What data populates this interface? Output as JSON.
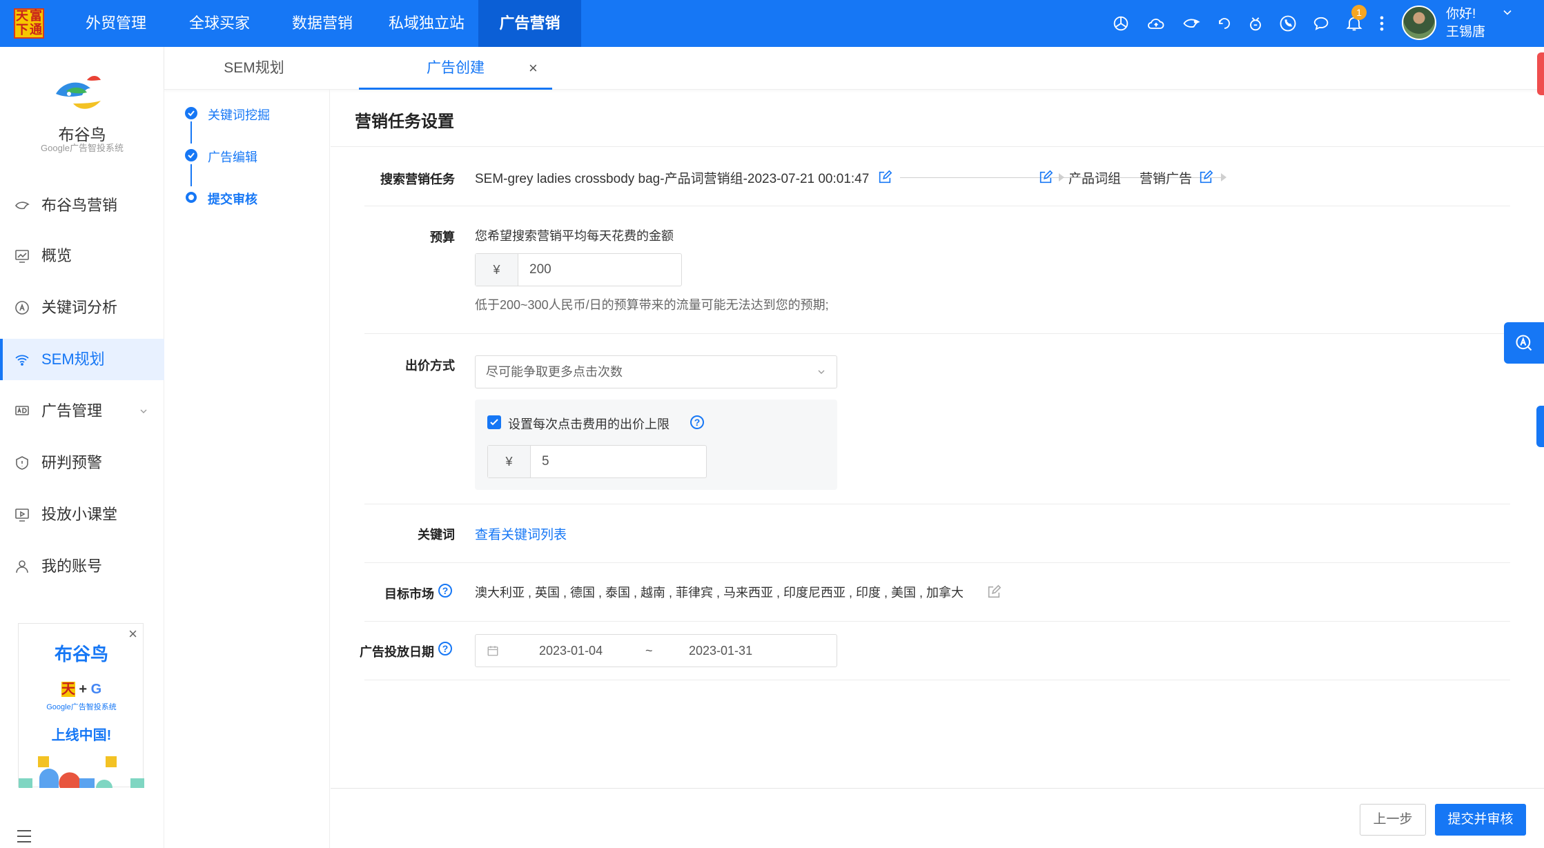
{
  "header": {
    "logo_chars": [
      "天",
      "富",
      "下",
      "通"
    ],
    "nav": [
      "外贸管理",
      "全球买家",
      "数据营销",
      "私域独立站",
      "广告营销"
    ],
    "active_nav": "广告营销",
    "notification_count": "1",
    "greeting": "你好!",
    "user_name": "王锡唐",
    "icons": [
      "openai-icon",
      "cloud-icon",
      "bird-icon",
      "refresh-icon",
      "robot-icon",
      "phone-icon",
      "chat-icon",
      "bell-icon",
      "more-icon"
    ]
  },
  "sidebar": {
    "brand_name": "布谷鸟",
    "brand_sub": "Google广告智投系统",
    "items": [
      {
        "label": "布谷鸟营销",
        "icon": "bird-icon"
      },
      {
        "label": "概览",
        "icon": "chart-icon"
      },
      {
        "label": "关键词分析",
        "icon": "keyword-icon"
      },
      {
        "label": "SEM规划",
        "icon": "wifi-icon"
      },
      {
        "label": "广告管理",
        "icon": "ad-icon"
      },
      {
        "label": "研判预警",
        "icon": "alert-icon"
      },
      {
        "label": "投放小课堂",
        "icon": "class-icon"
      },
      {
        "label": "我的账号",
        "icon": "user-icon"
      }
    ],
    "active_item": "SEM规划",
    "promo": {
      "title": "布谷鸟",
      "sub": "Google广告智投系统",
      "slogan": "上线中国!"
    }
  },
  "tabs": {
    "items": [
      "SEM规划",
      "广告创建"
    ],
    "active": "广告创建",
    "close_glyph": "×"
  },
  "steps": [
    "关键词挖掘",
    "广告编辑",
    "提交审核"
  ],
  "form": {
    "title": "营销任务设置",
    "task_label": "搜索营销任务",
    "task_name": "SEM-grey ladies crossbody bag-产品词营销组-2023-07-21 00:01:47",
    "task_group": "产品词组",
    "task_ad": "营销广告",
    "budget_label": "预算",
    "budget_desc": "您希望搜索营销平均每天花费的金额",
    "currency": "¥",
    "budget_value": "200",
    "budget_hint": "低于200~300人民币/日的预算带来的流量可能无法达到您的预期;",
    "bid_label": "出价方式",
    "bid_value": "尽可能争取更多点击次数",
    "cpc_check_label": "设置每次点击费用的出价上限",
    "cpc_value": "5",
    "keyword_label": "关键词",
    "keyword_link": "查看关键词列表",
    "market_label": "目标市场",
    "markets": "澳大利亚 , 英国 , 德国 , 泰国 , 越南 , 菲律宾 , 马来西亚 , 印度尼西亚 , 印度 , 美国 , 加拿大",
    "date_label": "广告投放日期",
    "date_start": "2023-01-04",
    "date_sep": "~",
    "date_end": "2023-01-31"
  },
  "footer": {
    "prev": "上一步",
    "submit": "提交并审核"
  },
  "colors": {
    "primary": "#1677f5",
    "header_active": "#0b5fd6"
  }
}
